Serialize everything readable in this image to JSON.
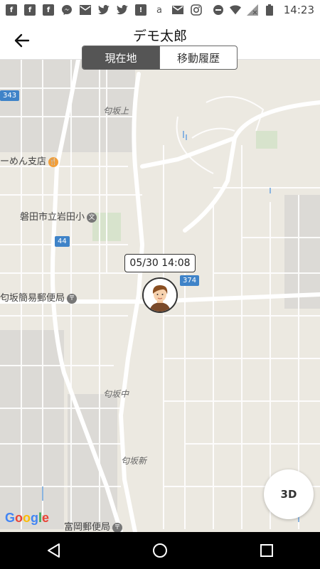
{
  "statusbar": {
    "time": "14:23",
    "left_icons": [
      "facebook-icon",
      "facebook-icon",
      "facebook-icon",
      "messenger-icon",
      "mail-icon",
      "twitter-icon",
      "twitter-icon",
      "alert-icon",
      "amazon-icon",
      "gmail-icon",
      "instagram-icon"
    ],
    "right_icons": [
      "dnd-icon",
      "wifi-icon",
      "signal-icon",
      "battery-icon"
    ]
  },
  "header": {
    "title": "デモ太郎",
    "tabs": [
      {
        "label": "現在地",
        "active": true
      },
      {
        "label": "移動履歴",
        "active": false
      }
    ]
  },
  "map": {
    "labels": {
      "sakasagami": "匂坂上",
      "ramen": "ーめん支店",
      "school": "磐田市立岩田小",
      "post1": "匂坂簡易郵便局",
      "sakanaka": "匂坂中",
      "sakashin": "匂坂新",
      "post2": "富岡郵便局"
    },
    "shields": {
      "r343": "343",
      "r44": "44",
      "r374": "374"
    },
    "timestamp": "05/30 14:08",
    "button_3d": "3D",
    "google_logo": "Google"
  },
  "colors": {
    "accent": "#555555",
    "map_bg": "#ece9e1",
    "road": "#ffffff",
    "shield": "#3f83c8"
  }
}
